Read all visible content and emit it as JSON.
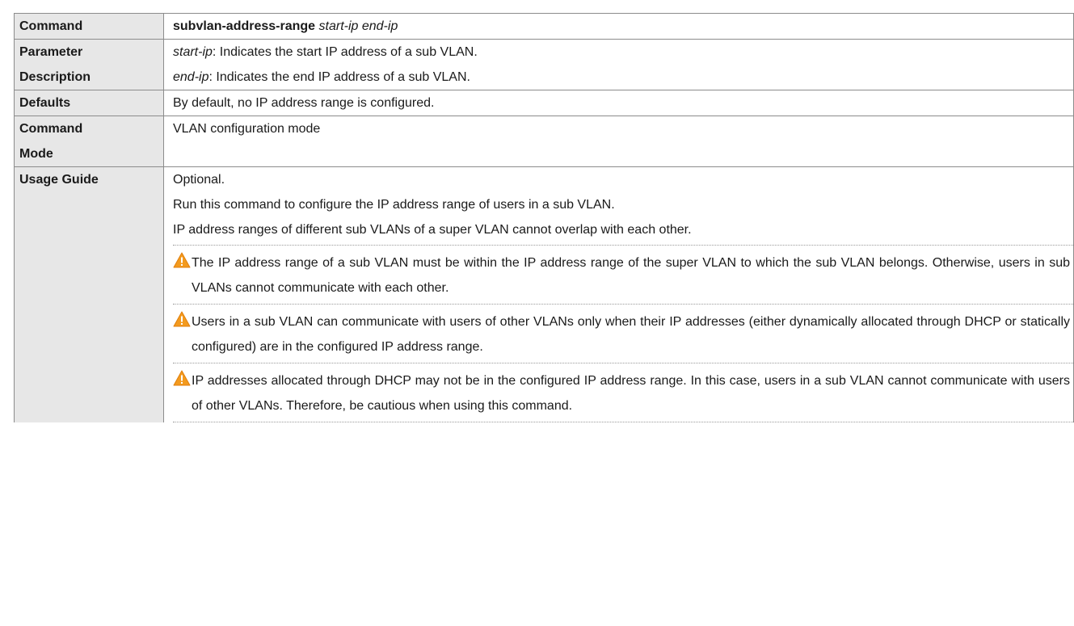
{
  "rows": {
    "command": {
      "label": "Command",
      "cmd_name": "subvlan-address-range",
      "cmd_args": "start-ip end-ip"
    },
    "parameter": {
      "label_line1": "Parameter",
      "label_line2": "Description",
      "params": [
        {
          "name": "start-ip",
          "desc": ": Indicates the start IP address of a sub VLAN."
        },
        {
          "name": "end-ip",
          "desc": ": Indicates the end IP address of a sub VLAN."
        }
      ]
    },
    "defaults": {
      "label": "Defaults",
      "text": "By default, no IP address range is configured."
    },
    "command_mode": {
      "label_line1": "Command",
      "label_line2": "Mode",
      "text": "VLAN configuration mode"
    },
    "usage_guide": {
      "label": "Usage Guide",
      "lines": [
        "Optional.",
        "Run this command to configure the IP address range of users in a sub VLAN.",
        "IP address ranges of different sub VLANs of a super VLAN cannot overlap with each other."
      ],
      "notes": [
        {
          "icon": "warning-icon",
          "text": "The IP address range of a sub VLAN must be within the IP address range of the super VLAN to which the sub VLAN belongs. Otherwise, users in sub VLANs cannot communicate with each other."
        },
        {
          "icon": "warning-icon",
          "text": "Users in a sub VLAN can communicate with users of other VLANs only when their IP addresses (either dynamically allocated through DHCP or statically configured) are in the configured IP address range."
        },
        {
          "icon": "warning-icon",
          "text": "IP addresses allocated through DHCP may not be in the configured IP address range. In this case, users in a sub VLAN cannot communicate with users of other VLANs.  Therefore, be cautious when using this command."
        }
      ]
    }
  },
  "colors": {
    "label_bg": "#e7e7e7",
    "border": "#8c8c8c",
    "warning_fill": "#f39a1e"
  }
}
